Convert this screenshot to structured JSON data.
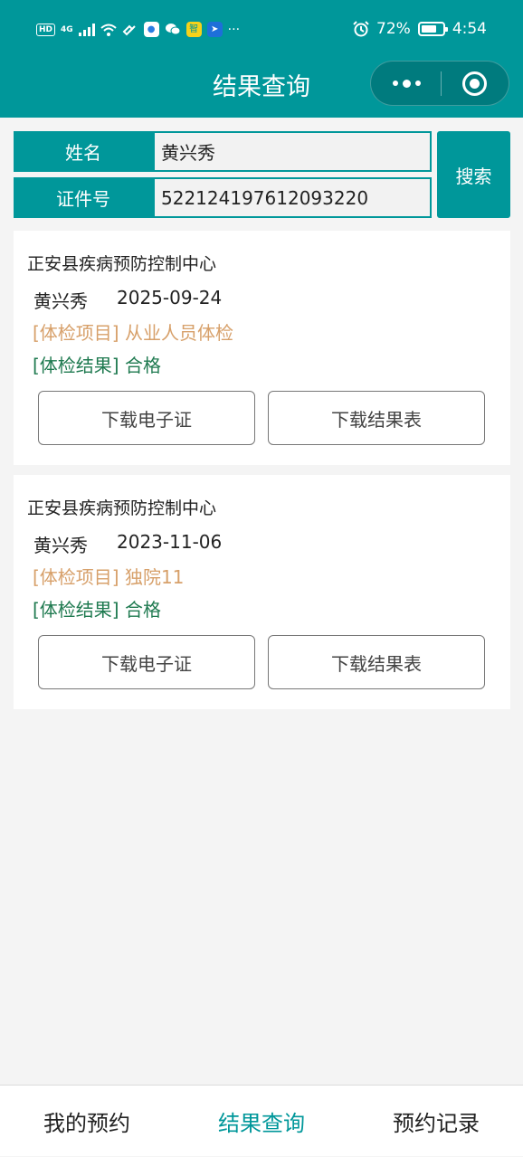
{
  "status_bar": {
    "hd": "HD",
    "network": "4G",
    "app_badge_1": "智",
    "more": "···",
    "battery_percent": "72%",
    "battery_level": 0.72,
    "time": "4:54"
  },
  "header": {
    "title": "结果查询"
  },
  "search": {
    "name_label": "姓名",
    "name_value": "黄兴秀",
    "id_label": "证件号",
    "id_value": "522124197612093220",
    "button_label": "搜索"
  },
  "results": [
    {
      "org": "正安县疾病预防控制中心",
      "name": "黄兴秀",
      "date": "2025-09-24",
      "item": "[体检项目] 从业人员体检",
      "result": "[体检结果] 合格",
      "download_cert": "下载电子证",
      "download_table": "下载结果表"
    },
    {
      "org": "正安县疾病预防控制中心",
      "name": "黄兴秀",
      "date": "2023-11-06",
      "item": "[体检项目] 独院11",
      "result": "[体检结果] 合格",
      "download_cert": "下载电子证",
      "download_table": "下载结果表"
    }
  ],
  "bottom_nav": {
    "tabs": [
      {
        "label": "我的预约",
        "active": false
      },
      {
        "label": "结果查询",
        "active": true
      },
      {
        "label": "预约记录",
        "active": false
      }
    ]
  },
  "colors": {
    "primary": "#00979a",
    "item_text": "#d7a06a",
    "result_text": "#1f7a50",
    "background": "#f4f4f4"
  }
}
